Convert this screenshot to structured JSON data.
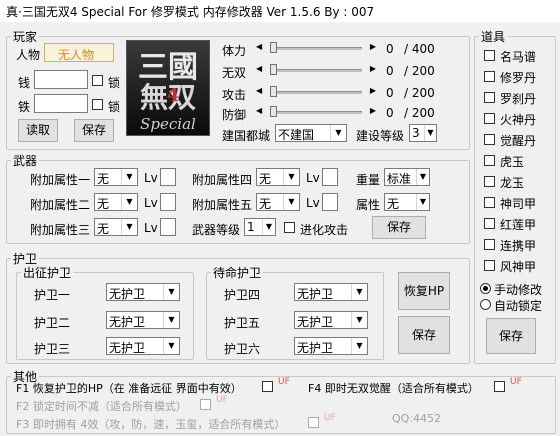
{
  "window": {
    "title": "真·三国无双4 Special For 修罗模式 内存修改器 Ver 1.5.6 By : 007"
  },
  "player": {
    "legend": "玩家",
    "person_label": "人物",
    "person_value": "无人物",
    "money_label": "钱",
    "iron_label": "铁",
    "lock_label": "锁",
    "read_btn": "读取",
    "save_btn": "保存",
    "logo_text_1": "三國",
    "logo_text_2": "無双",
    "logo_text_3": "Special",
    "stats": [
      {
        "label": "体力",
        "value": "0",
        "max": "/ 400"
      },
      {
        "label": "无双",
        "value": "0",
        "max": "/ 200"
      },
      {
        "label": "攻击",
        "value": "0",
        "max": "/ 200"
      },
      {
        "label": "防御",
        "value": "0",
        "max": "/ 200"
      }
    ],
    "city_label": "建国都城",
    "city_value": "不建国",
    "build_label": "建设等级",
    "build_value": "3"
  },
  "weapon": {
    "legend": "武器",
    "attrs": [
      {
        "label": "附加属性一",
        "value": "无"
      },
      {
        "label": "附加属性二",
        "value": "无"
      },
      {
        "label": "附加属性三",
        "value": "无"
      },
      {
        "label": "附加属性四",
        "value": "无"
      },
      {
        "label": "附加属性五",
        "value": "无"
      }
    ],
    "lv_label": "Lv",
    "weight_label": "重量",
    "weight_value": "标准",
    "prop_label": "属性",
    "prop_value": "无",
    "level_label": "武器等级",
    "level_value": "1",
    "evolve_label": "进化攻击",
    "save_btn": "保存"
  },
  "guard": {
    "legend": "护卫",
    "active_legend": "出征护卫",
    "standby_legend": "待命护卫",
    "active": [
      {
        "label": "护卫一",
        "value": "无护卫"
      },
      {
        "label": "护卫二",
        "value": "无护卫"
      },
      {
        "label": "护卫三",
        "value": "无护卫"
      }
    ],
    "standby": [
      {
        "label": "护卫四",
        "value": "无护卫"
      },
      {
        "label": "护卫五",
        "value": "无护卫"
      },
      {
        "label": "护卫六",
        "value": "无护卫"
      }
    ],
    "restore_btn": "恢复HP",
    "save_btn": "保存"
  },
  "items": {
    "legend": "道具",
    "list": [
      "名马谱",
      "修罗丹",
      "罗刹丹",
      "火神丹",
      "觉醒丹",
      "虎玉",
      "龙玉",
      "神司甲",
      "红莲甲",
      "连携甲",
      "风神甲"
    ],
    "manual_label": "手动修改",
    "auto_label": "自动锁定",
    "save_btn": "保存"
  },
  "other": {
    "legend": "其他",
    "f1": "F1 恢复护卫的HP（在 准备远征 界面中有效）",
    "f2": "F2 锁定时间不减（适合所有模式）",
    "f3": "F3 即时拥有 4效（攻，防，速，玉玺，适合所有模式）",
    "f4": "F4 即时无双觉醒（适合所有模式）",
    "qq": "QQ:4452",
    "hotkey_tag": "UF"
  }
}
